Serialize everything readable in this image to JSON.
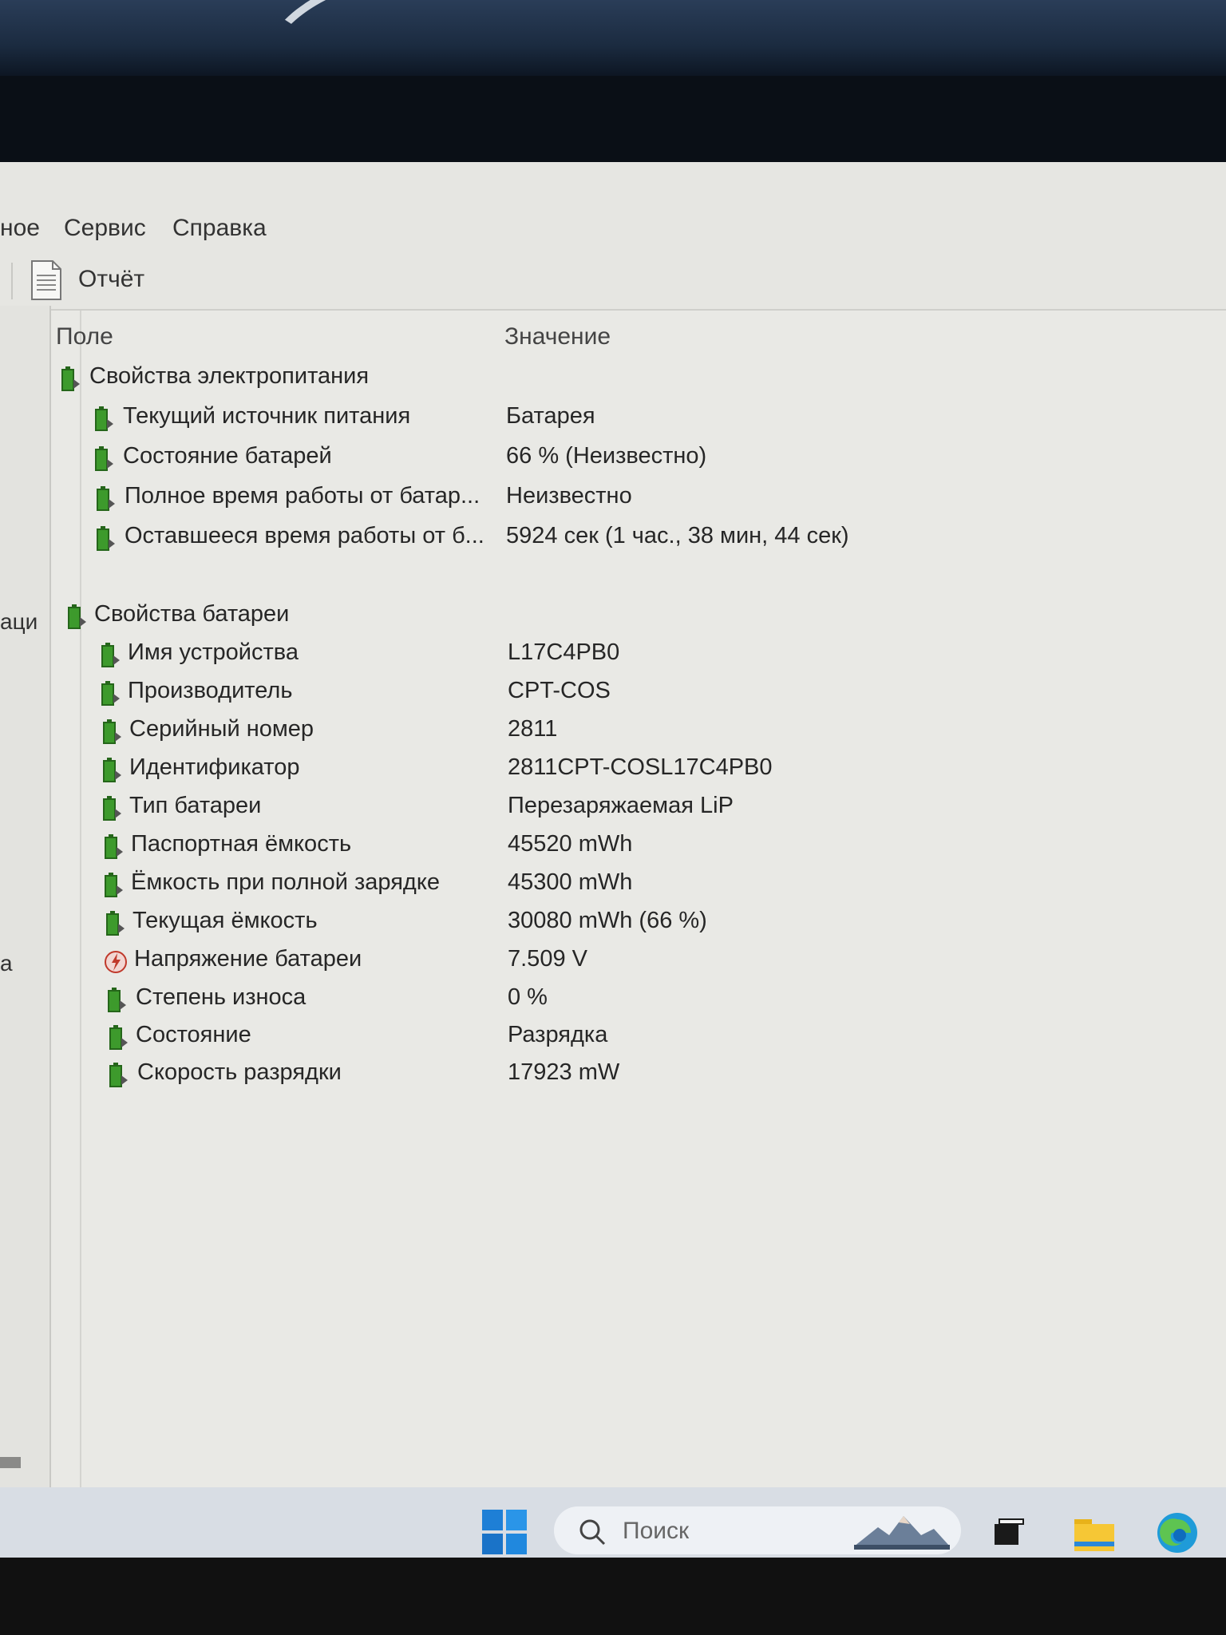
{
  "menu": {
    "items": [
      "ное",
      "Сервис",
      "Справка"
    ]
  },
  "toolbar": {
    "report_label": "Отчёт"
  },
  "left_pane": {
    "fragments": [
      "аци",
      "а"
    ]
  },
  "columns": {
    "field": "Поле",
    "value": "Значение"
  },
  "power_section": {
    "title": "Свойства электропитания",
    "rows": [
      {
        "label": "Текущий источник питания",
        "value": "Батарея"
      },
      {
        "label": "Состояние батарей",
        "value": "66 % (Неизвестно)"
      },
      {
        "label": "Полное время работы от батар...",
        "value": "Неизвестно"
      },
      {
        "label": "Оставшееся время работы от б...",
        "value": "5924 сек (1 час., 38 мин, 44 сек)"
      }
    ]
  },
  "battery_section": {
    "title": "Свойства батареи",
    "rows": [
      {
        "label": "Имя устройства",
        "value": "L17C4PB0",
        "icon": "battery-icon"
      },
      {
        "label": "Производитель",
        "value": "CPT-COS",
        "icon": "battery-icon"
      },
      {
        "label": "Серийный номер",
        "value": "2811",
        "icon": "battery-icon"
      },
      {
        "label": "Идентификатор",
        "value": "2811CPT-COSL17C4PB0",
        "icon": "battery-icon"
      },
      {
        "label": "Тип батареи",
        "value": "Перезаряжаемая LiP",
        "icon": "battery-icon"
      },
      {
        "label": "Паспортная ёмкость",
        "value": "45520 mWh",
        "icon": "battery-icon"
      },
      {
        "label": "Ёмкость при полной зарядке",
        "value": "45300 mWh",
        "icon": "battery-icon"
      },
      {
        "label": "Текущая ёмкость",
        "value": "30080 mWh  (66 %)",
        "icon": "battery-icon"
      },
      {
        "label": "Напряжение батареи",
        "value": "7.509 V",
        "icon": "voltage-icon"
      },
      {
        "label": "Степень износа",
        "value": "0 %",
        "icon": "battery-icon"
      },
      {
        "label": "Состояние",
        "value": "Разрядка",
        "icon": "battery-icon"
      },
      {
        "label": "Скорость разрядки",
        "value": "17923 mW",
        "icon": "battery-icon"
      }
    ]
  },
  "taskbar": {
    "search_label": "Поиск"
  },
  "colors": {
    "battery_green": "#3d9a2c",
    "window_bg": "#e9e9e5",
    "text": "#262626",
    "accent_blue": "#1e7fd6"
  }
}
